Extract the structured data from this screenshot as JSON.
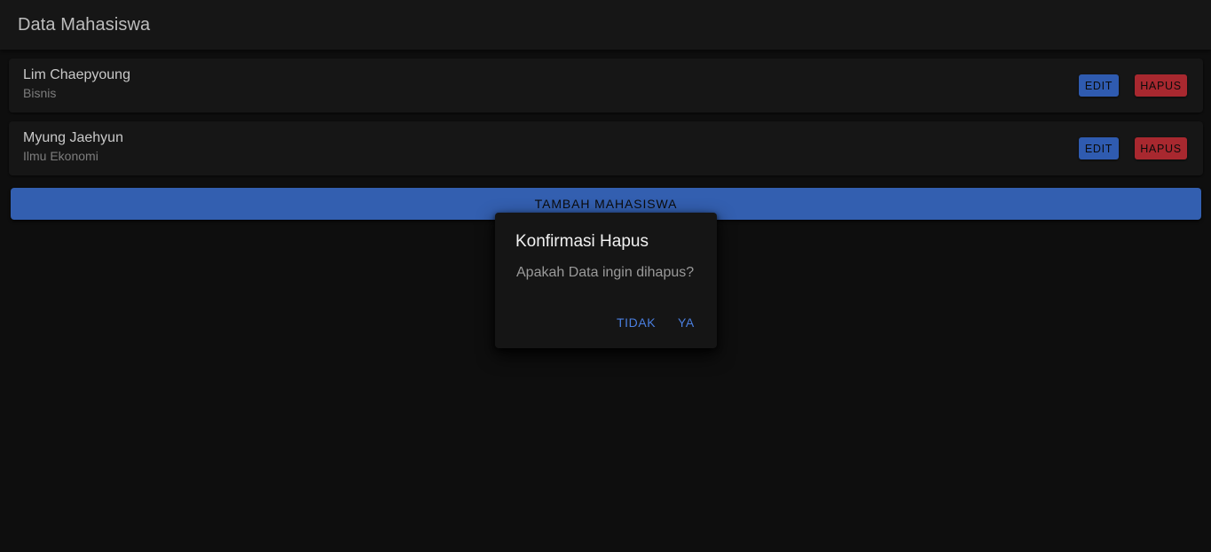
{
  "header": {
    "title": "Data Mahasiswa"
  },
  "students": [
    {
      "name": "Lim Chaepyoung",
      "major": "Bisnis",
      "edit_label": "EDIT",
      "delete_label": "HAPUS"
    },
    {
      "name": "Myung Jaehyun",
      "major": "Ilmu Ekonomi",
      "edit_label": "EDIT",
      "delete_label": "HAPUS"
    }
  ],
  "add_button": {
    "label": "TAMBAH MAHASISWA"
  },
  "dialog": {
    "title": "Konfirmasi Hapus",
    "message": "Apakah Data ingin dihapus?",
    "cancel_label": "TIDAK",
    "confirm_label": "YA"
  },
  "colors": {
    "background": "#0e0e0e",
    "surface": "#161616",
    "primary": "#2f5bb0",
    "danger": "#a8282f",
    "dialog_action": "#4a7fe0"
  }
}
